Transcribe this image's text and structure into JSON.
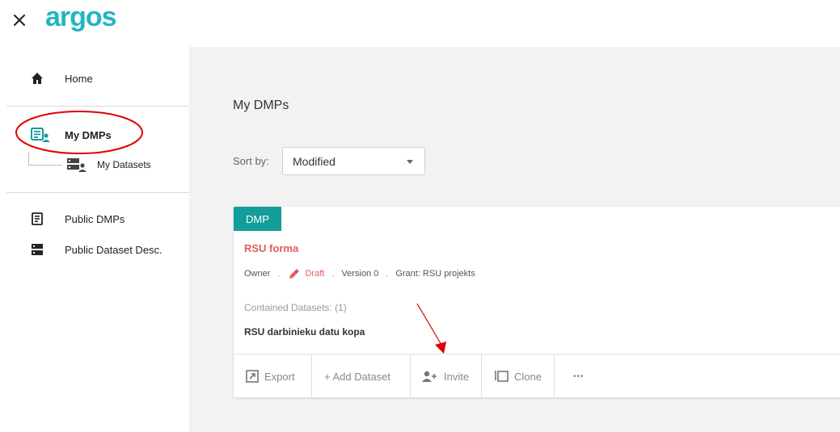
{
  "app": {
    "logo_text": "argos"
  },
  "sidebar": {
    "items": [
      {
        "label": "Home",
        "icon": "home-icon"
      },
      {
        "label": "My DMPs",
        "icon": "my-dmps-icon"
      },
      {
        "label": "My Datasets",
        "icon": "my-datasets-icon"
      },
      {
        "label": "Public DMPs",
        "icon": "public-dmps-icon"
      },
      {
        "label": "Public Dataset Desc.",
        "icon": "public-datasets-icon"
      }
    ]
  },
  "main": {
    "title": "My DMPs",
    "sort": {
      "label": "Sort by:",
      "value": "Modified"
    },
    "card": {
      "tag": "DMP",
      "title": "RSU forma",
      "meta": {
        "owner": "Owner",
        "sep": ".",
        "status": "Draft",
        "version": "Version 0",
        "grant": "Grant: RSU projekts"
      },
      "contained_label": "Contained Datasets: (1)",
      "dataset_name": "RSU darbinieku datu kopa",
      "actions": {
        "export": "Export",
        "add_dataset": "+ Add Dataset",
        "invite": "Invite",
        "clone": "Clone",
        "more": "•••"
      }
    }
  },
  "colors": {
    "accent": "#129d99",
    "logo": "#23b5c2",
    "title_red": "#e55b5b",
    "annotation_red": "#e00000",
    "background": "#f2f2f2"
  }
}
